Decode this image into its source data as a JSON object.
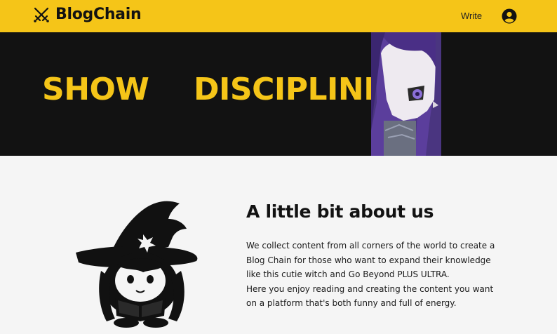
{
  "header": {
    "brand_name": "BlogChain",
    "brand_icon": "crossed-swords-icon",
    "write_label": "Write",
    "account_icon": "user-circle-icon"
  },
  "hero": {
    "word_1": "SHOW",
    "word_2": "DISCIPLINE",
    "image": "anime-girl-portrait"
  },
  "about": {
    "image": "witch-reading-book-illustration",
    "title": "A little bit about us",
    "paragraph_1": "We collect content from all corners of the world to create a Blog Chain for those who want to expand their knowledge like this cutie witch and Go Beyond PLUS ULTRA.",
    "paragraph_2": "Here you enjoy reading and creating the content you want on a platform that's both funny and full of energy."
  },
  "colors": {
    "accent": "#f5c518",
    "hero_bg": "#121212",
    "page_bg": "#f5f5f5",
    "text": "#121212"
  }
}
